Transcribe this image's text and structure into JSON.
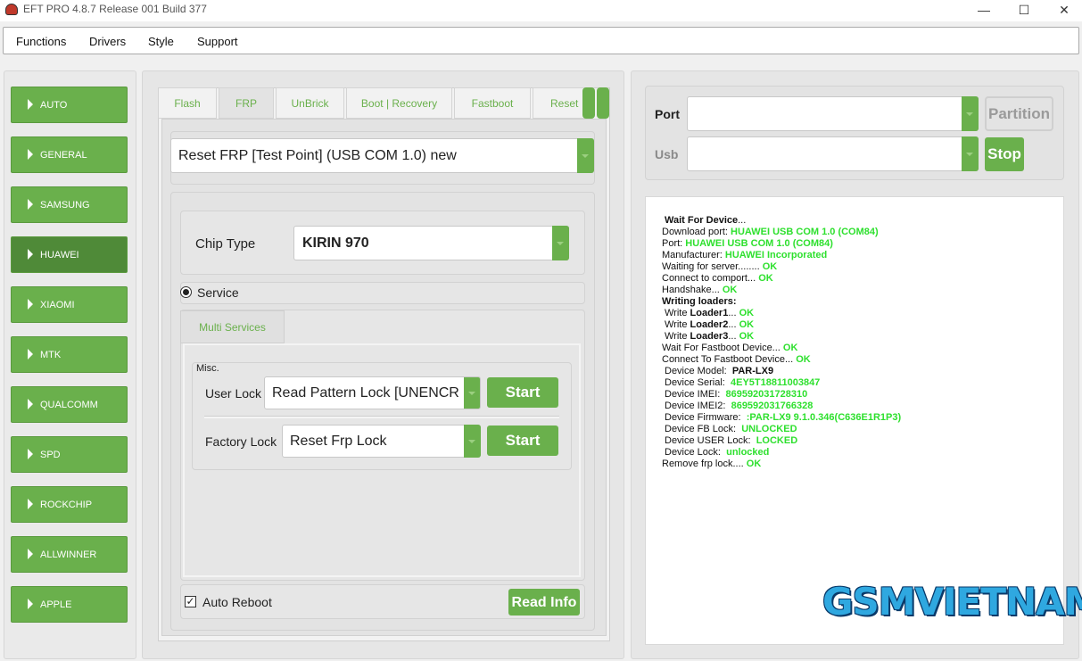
{
  "window": {
    "title": "EFT PRO 4.8.7 Release 001 Build 377"
  },
  "menu": [
    "Functions",
    "Drivers",
    "Style",
    "Support"
  ],
  "brands": [
    {
      "label": "AUTO",
      "active": false
    },
    {
      "label": "GENERAL",
      "active": false
    },
    {
      "label": "SAMSUNG",
      "active": false
    },
    {
      "label": "HUAWEI",
      "active": true
    },
    {
      "label": "XIAOMI",
      "active": false
    },
    {
      "label": "MTK",
      "active": false
    },
    {
      "label": "QUALCOMM",
      "active": false
    },
    {
      "label": "SPD",
      "active": false
    },
    {
      "label": "ROCKCHIP",
      "active": false
    },
    {
      "label": "ALLWINNER",
      "active": false
    },
    {
      "label": "APPLE",
      "active": false
    }
  ],
  "tabs": [
    "Flash",
    "FRP",
    "UnBrick",
    "Boot | Recovery",
    "Fastboot",
    "Reset S"
  ],
  "active_tab": "FRP",
  "operation": {
    "selected": "Reset FRP [Test Point] (USB COM 1.0) new"
  },
  "chip": {
    "label": "Chip Type",
    "value": "KIRIN 970"
  },
  "service": {
    "label": "Service",
    "checked": true
  },
  "subtab": {
    "label": "Multi Services"
  },
  "misc": {
    "title": "Misc.",
    "user_lock": {
      "label": "User Lock",
      "value": "Read Pattern Lock [UNENCRY",
      "button": "Start"
    },
    "factory_lock": {
      "label": "Factory Lock",
      "value": "Reset Frp Lock",
      "button": "Start"
    }
  },
  "auto_reboot": {
    "label": "Auto Reboot",
    "checked": true
  },
  "read_info": {
    "label": "Read Info"
  },
  "port": {
    "label": "Port",
    "value": "",
    "button": "Partition"
  },
  "usb": {
    "label": "Usb",
    "value": "",
    "button": "Stop"
  },
  "log": [
    {
      "indent": 1,
      "parts": [
        {
          "t": "Wait For Device",
          "s": "b"
        },
        {
          "t": "...",
          "s": ""
        }
      ]
    },
    {
      "indent": 0,
      "parts": [
        {
          "t": "Download port: ",
          "s": ""
        },
        {
          "t": "HUAWEI USB COM 1.0 (COM84)",
          "s": "ok"
        }
      ]
    },
    {
      "indent": 0,
      "parts": [
        {
          "t": "Port: ",
          "s": ""
        },
        {
          "t": "HUAWEI USB COM 1.0 (COM84)",
          "s": "ok"
        }
      ]
    },
    {
      "indent": 0,
      "parts": [
        {
          "t": "Manufacturer: ",
          "s": ""
        },
        {
          "t": "HUAWEI Incorporated",
          "s": "ok"
        }
      ]
    },
    {
      "indent": 0,
      "parts": [
        {
          "t": "Waiting for server........ ",
          "s": ""
        },
        {
          "t": "OK",
          "s": "ok"
        }
      ]
    },
    {
      "indent": 0,
      "parts": [
        {
          "t": "Connect to comport... ",
          "s": ""
        },
        {
          "t": "OK",
          "s": "ok"
        }
      ]
    },
    {
      "indent": 0,
      "parts": [
        {
          "t": "Handshake... ",
          "s": ""
        },
        {
          "t": "OK",
          "s": "ok"
        }
      ]
    },
    {
      "indent": 0,
      "parts": [
        {
          "t": "Writing loaders:",
          "s": "b"
        }
      ]
    },
    {
      "indent": 1,
      "parts": [
        {
          "t": "Write ",
          "s": ""
        },
        {
          "t": "Loader1",
          "s": "b"
        },
        {
          "t": "... ",
          "s": ""
        },
        {
          "t": "OK",
          "s": "ok"
        }
      ]
    },
    {
      "indent": 1,
      "parts": [
        {
          "t": "Write ",
          "s": ""
        },
        {
          "t": "Loader2",
          "s": "b"
        },
        {
          "t": "... ",
          "s": ""
        },
        {
          "t": "OK",
          "s": "ok"
        }
      ]
    },
    {
      "indent": 1,
      "parts": [
        {
          "t": "Write ",
          "s": ""
        },
        {
          "t": "Loader3",
          "s": "b"
        },
        {
          "t": "... ",
          "s": ""
        },
        {
          "t": "OK",
          "s": "ok"
        }
      ]
    },
    {
      "indent": 0,
      "parts": [
        {
          "t": "Wait For Fastboot Device... ",
          "s": ""
        },
        {
          "t": "OK",
          "s": "ok"
        }
      ]
    },
    {
      "indent": 0,
      "parts": [
        {
          "t": "Connect To Fastboot Device... ",
          "s": ""
        },
        {
          "t": "OK",
          "s": "ok"
        }
      ]
    },
    {
      "indent": 1,
      "parts": [
        {
          "t": "Device Model:  ",
          "s": ""
        },
        {
          "t": "PAR-LX9",
          "s": "b"
        }
      ]
    },
    {
      "indent": 1,
      "parts": [
        {
          "t": "Device Serial:  ",
          "s": ""
        },
        {
          "t": "4EY5T18811003847",
          "s": "ok"
        }
      ]
    },
    {
      "indent": 1,
      "parts": [
        {
          "t": "Device IMEI:  ",
          "s": ""
        },
        {
          "t": "869592031728310",
          "s": "ok"
        }
      ]
    },
    {
      "indent": 1,
      "parts": [
        {
          "t": "Device IMEI2:  ",
          "s": ""
        },
        {
          "t": "869592031766328",
          "s": "ok"
        }
      ]
    },
    {
      "indent": 1,
      "parts": [
        {
          "t": "Device Firmware:  ",
          "s": ""
        },
        {
          "t": ":PAR-LX9 9.1.0.346(C636E1R1P3)",
          "s": "ok"
        }
      ]
    },
    {
      "indent": 1,
      "parts": [
        {
          "t": "Device FB Lock:  ",
          "s": ""
        },
        {
          "t": "UNLOCKED",
          "s": "ok"
        }
      ]
    },
    {
      "indent": 1,
      "parts": [
        {
          "t": "Device USER Lock:  ",
          "s": ""
        },
        {
          "t": "LOCKED",
          "s": "ok"
        }
      ]
    },
    {
      "indent": 1,
      "parts": [
        {
          "t": "Device Lock:  ",
          "s": ""
        },
        {
          "t": "unlocked",
          "s": "ok"
        }
      ]
    },
    {
      "indent": 0,
      "parts": [
        {
          "t": "Remove frp lock.... ",
          "s": ""
        },
        {
          "t": "OK",
          "s": "ok"
        }
      ]
    }
  ],
  "watermark": "GSMVIETNAM",
  "colors": {
    "accent": "#6ab04c",
    "accent_active": "#4f8a38",
    "ok": "#2ee02e"
  }
}
